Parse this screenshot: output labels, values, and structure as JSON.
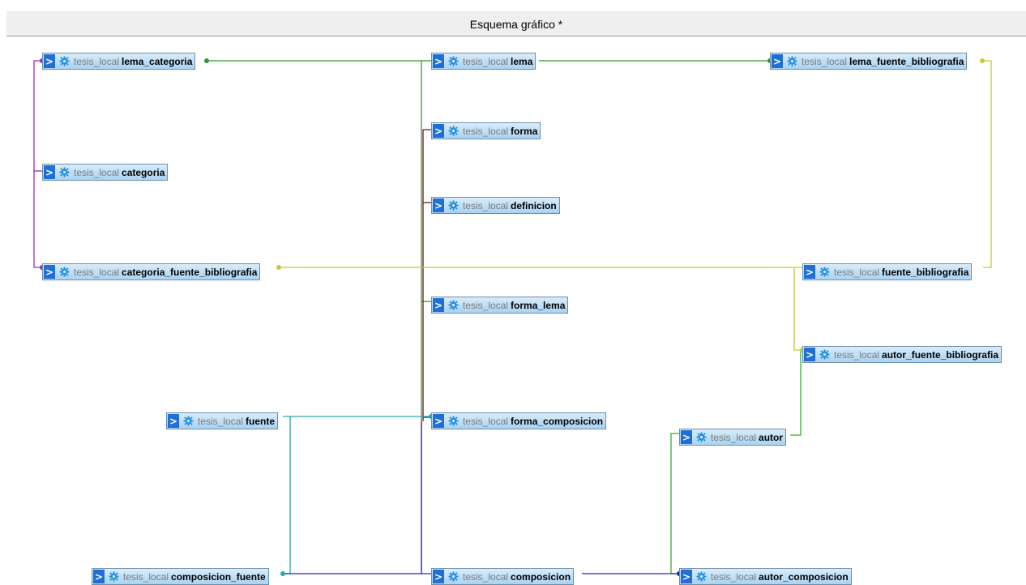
{
  "header": {
    "title": "Esquema gráfico *"
  },
  "icons": {
    "toggle": "chevron-right-icon",
    "options": "gear-icon"
  },
  "colors": {
    "header_bg": "#efefef",
    "table_gradient_top": "#d9ecfa",
    "table_gradient_bottom": "#a9d2f2",
    "toggle_bg": "#1f6fd6",
    "gear": "#1f8fe0",
    "db_text": "#7a7a7a"
  },
  "tables": [
    {
      "id": "lema_categoria",
      "db": "tesis_local",
      "name": "lema_categoria"
    },
    {
      "id": "lema",
      "db": "tesis_local",
      "name": "lema"
    },
    {
      "id": "lema_fuente_bibliografia",
      "db": "tesis_local",
      "name": "lema_fuente_bibliografia"
    },
    {
      "id": "forma",
      "db": "tesis_local",
      "name": "forma"
    },
    {
      "id": "categoria",
      "db": "tesis_local",
      "name": "categoria"
    },
    {
      "id": "definicion",
      "db": "tesis_local",
      "name": "definicion"
    },
    {
      "id": "categoria_fuente_bibliografia",
      "db": "tesis_local",
      "name": "categoria_fuente_bibliografia"
    },
    {
      "id": "fuente_bibliografia",
      "db": "tesis_local",
      "name": "fuente_bibliografia"
    },
    {
      "id": "forma_lema",
      "db": "tesis_local",
      "name": "forma_lema"
    },
    {
      "id": "autor_fuente_bibliografia",
      "db": "tesis_local",
      "name": "autor_fuente_bibliografia"
    },
    {
      "id": "fuente",
      "db": "tesis_local",
      "name": "fuente"
    },
    {
      "id": "forma_composicion",
      "db": "tesis_local",
      "name": "forma_composicion"
    },
    {
      "id": "autor",
      "db": "tesis_local",
      "name": "autor"
    },
    {
      "id": "composicion_fuente",
      "db": "tesis_local",
      "name": "composicion_fuente"
    },
    {
      "id": "composicion",
      "db": "tesis_local",
      "name": "composicion"
    },
    {
      "id": "autor_composicion",
      "db": "tesis_local",
      "name": "autor_composicion"
    }
  ]
}
